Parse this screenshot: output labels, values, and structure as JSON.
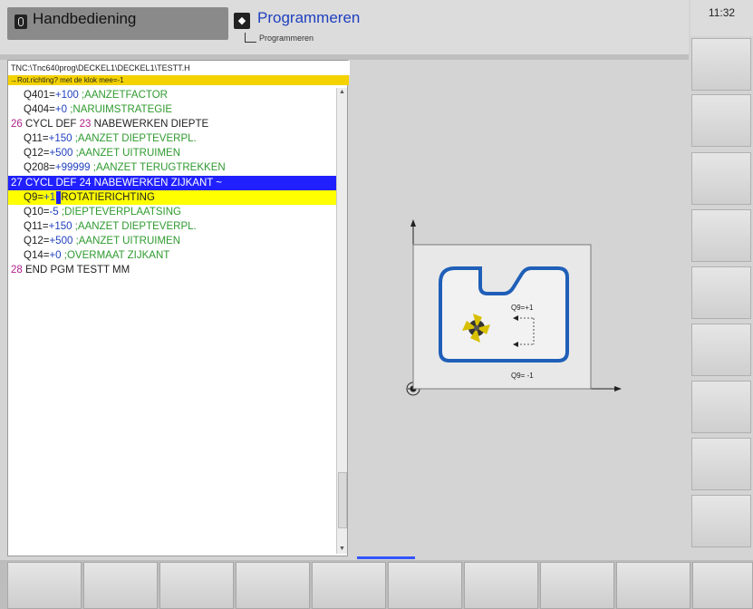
{
  "header": {
    "mode_manual": "Handbediening",
    "mode_program": "Programmeren",
    "mode_program_sub": "Programmeren"
  },
  "clock": "11:32",
  "program": {
    "path": "TNC:\\Tnc640prog\\DECKEL1\\DECKEL1\\TESTT.H",
    "dialog": "→Rot.richting? met de klok mee=-1",
    "lines": [
      {
        "ln": "",
        "kw": "",
        "q": "Q401=",
        "v": "+100",
        "c": ";AANZETFACTOR",
        "state": "normal",
        "indent": true
      },
      {
        "ln": "",
        "kw": "",
        "q": "Q404=",
        "v": "+0",
        "c": ";NARUIMSTRATEGIE",
        "state": "normal",
        "indent": true
      },
      {
        "ln": "26",
        "kw": "CYCL DEF ",
        "q": "",
        "v": "23",
        "c": "NABEWERKEN DIEPTE",
        "state": "head",
        "indent": false
      },
      {
        "ln": "",
        "kw": "",
        "q": "Q11=",
        "v": "+150",
        "c": ";AANZET DIEPTEVERPL.",
        "state": "normal",
        "indent": true
      },
      {
        "ln": "",
        "kw": "",
        "q": "Q12=",
        "v": "+500",
        "c": ";AANZET UITRUIMEN",
        "state": "normal",
        "indent": true
      },
      {
        "ln": "",
        "kw": "",
        "q": "Q208=",
        "v": "+99999",
        "c": ";AANZET TERUGTREKKEN",
        "state": "normal",
        "indent": true
      },
      {
        "ln": "27",
        "kw": "CYCL DEF ",
        "q": "",
        "v": "24",
        "c": "NABEWERKEN ZIJKANT ~",
        "state": "sel",
        "indent": false
      },
      {
        "ln": "",
        "kw": "",
        "q": "Q9=",
        "v": "+1",
        "c": "ROTATIERICHTING",
        "state": "cur",
        "indent": true
      },
      {
        "ln": "",
        "kw": "",
        "q": "Q10=",
        "v": "-5",
        "c": ";DIEPTEVERPLAATSING",
        "state": "normal",
        "indent": true
      },
      {
        "ln": "",
        "kw": "",
        "q": "Q11=",
        "v": "+150",
        "c": ";AANZET DIEPTEVERPL.",
        "state": "normal",
        "indent": true
      },
      {
        "ln": "",
        "kw": "",
        "q": "Q12=",
        "v": "+500",
        "c": ";AANZET UITRUIMEN",
        "state": "normal",
        "indent": true
      },
      {
        "ln": "",
        "kw": "",
        "q": "Q14=",
        "v": "+0",
        "c": ";OVERMAAT ZIJKANT",
        "state": "normal",
        "indent": true
      },
      {
        "ln": "28",
        "kw": "END PGM TESTT MM",
        "q": "",
        "v": "",
        "c": "",
        "state": "head",
        "indent": false
      }
    ]
  },
  "illustration": {
    "label_top": "Q9=+1",
    "label_bottom": "Q9= -1",
    "colors": {
      "contour": "#1f5fb8",
      "tool": "#d8c000",
      "tool_dark": "#333333"
    }
  },
  "icons": {
    "manual": "hand-mode-icon",
    "program": "program-mode-icon",
    "sub": "program-folder-icon"
  }
}
